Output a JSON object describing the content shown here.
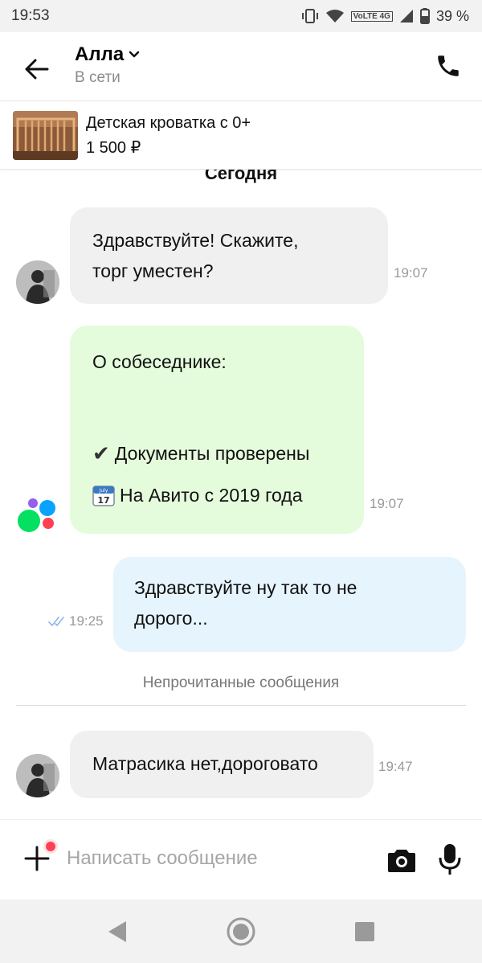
{
  "status_bar": {
    "time": "19:53",
    "network": "VoLTE 4G",
    "battery": "39 %"
  },
  "header": {
    "contact_name": "Алла",
    "contact_status": "В сети"
  },
  "listing": {
    "title": "Детская кроватка с 0+",
    "price": "1 500 ₽"
  },
  "chat": {
    "date_separator": "Сегодня",
    "messages": [
      {
        "direction": "in",
        "lines": [
          "Здравствуйте! Скажите,",
          "торг уместен?"
        ],
        "time": "19:07"
      },
      {
        "direction": "system",
        "heading": "О собеседнике:",
        "line1": "Документы проверены",
        "line2": "На Авито с 2019 года",
        "calendar_month": "July",
        "calendar_day": "17",
        "time": "19:07"
      },
      {
        "direction": "out",
        "lines": [
          "Здравствуйте  ну так то не",
          "дорого..."
        ],
        "time": "19:25"
      },
      {
        "direction": "in",
        "lines": [
          "Матрасика нет,дороговато"
        ],
        "time": "19:47"
      }
    ],
    "unread_label": "Непрочитанные сообщения"
  },
  "composer": {
    "placeholder": "Написать сообщение"
  },
  "colors": {
    "incoming_bubble": "#f0f0f0",
    "system_bubble": "#e5fcdc",
    "outgoing_bubble": "#e6f4fd",
    "notification_dot": "#ff4053",
    "read_ticks": "#8ab8e6"
  },
  "icons": {
    "back": "arrow-left-icon",
    "call": "phone-icon",
    "plus": "plus-icon",
    "camera": "camera-icon",
    "mic": "microphone-icon"
  }
}
